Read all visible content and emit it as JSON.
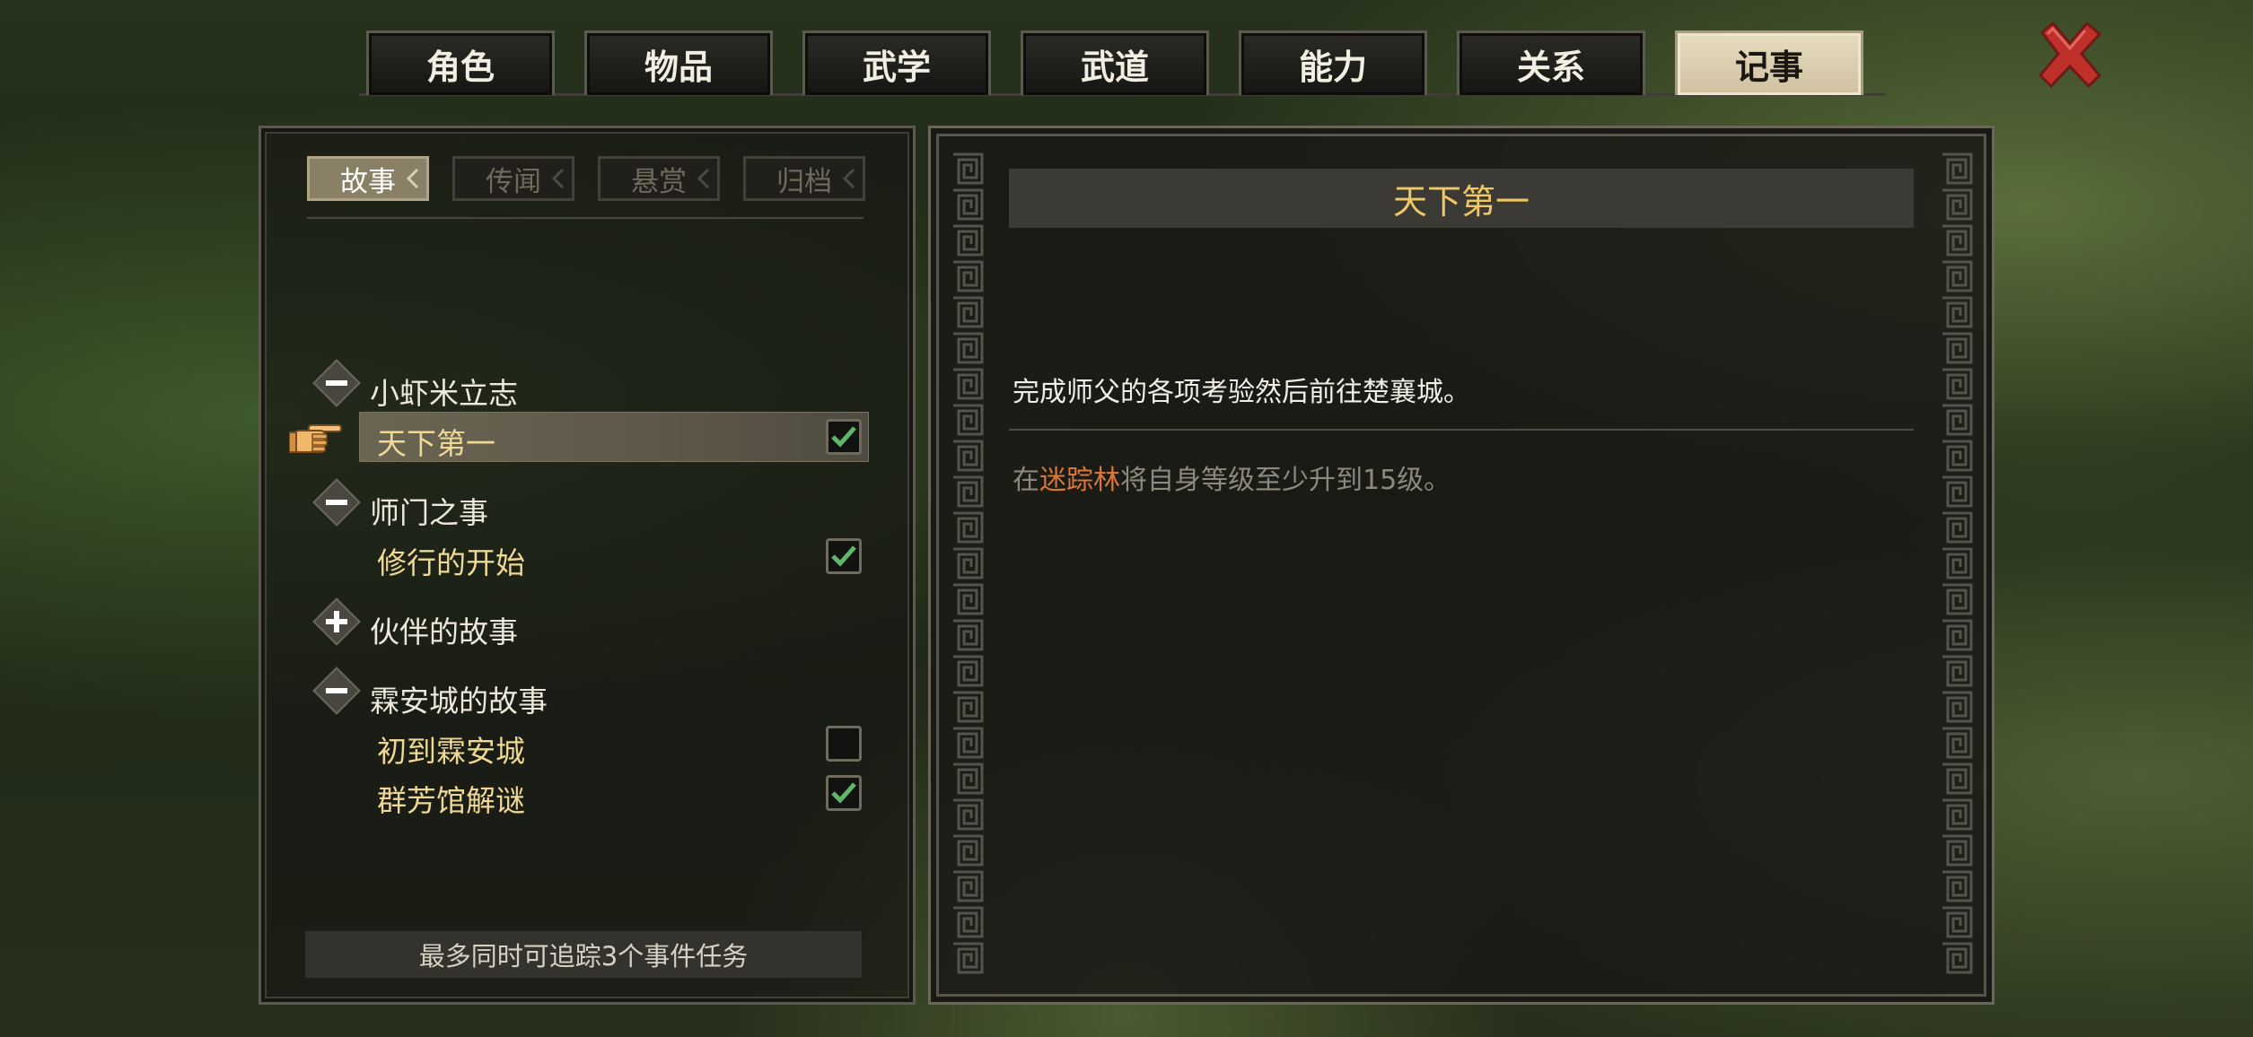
{
  "tabs": [
    {
      "label": "角色",
      "active": false
    },
    {
      "label": "物品",
      "active": false
    },
    {
      "label": "武学",
      "active": false
    },
    {
      "label": "武道",
      "active": false
    },
    {
      "label": "能力",
      "active": false
    },
    {
      "label": "关系",
      "active": false
    },
    {
      "label": "记事",
      "active": true
    }
  ],
  "subtabs": [
    {
      "label": "故事",
      "active": true
    },
    {
      "label": "传闻",
      "active": false
    },
    {
      "label": "悬赏",
      "active": false
    },
    {
      "label": "归档",
      "active": false
    }
  ],
  "quest_groups": [
    {
      "title": "小虾米立志",
      "expanded": true,
      "icon": "minus-icon",
      "quests": [
        {
          "label": "天下第一",
          "checked": true,
          "selected": true
        }
      ]
    },
    {
      "title": "师门之事",
      "expanded": true,
      "icon": "minus-icon",
      "quests": [
        {
          "label": "修行的开始",
          "checked": true,
          "selected": false
        }
      ]
    },
    {
      "title": "伙伴的故事",
      "expanded": false,
      "icon": "plus-icon",
      "quests": []
    },
    {
      "title": "霖安城的故事",
      "expanded": true,
      "icon": "minus-icon",
      "quests": [
        {
          "label": "初到霖安城",
          "checked": false,
          "selected": false
        },
        {
          "label": "群芳馆解谜",
          "checked": true,
          "selected": false
        }
      ]
    }
  ],
  "footer_note": "最多同时可追踪3个事件任务",
  "detail": {
    "title": "天下第一",
    "description": "完成师父的各项考验然后前往楚襄城。",
    "objective_prefix": "在",
    "objective_place": "迷踪林",
    "objective_suffix": "将自身等级至少升到15级。"
  },
  "colors": {
    "accent_gold": "#f0c864",
    "quest_yellow": "#efd794",
    "place_orange": "#d9763a",
    "close_red": "#c0302a",
    "check_green": "#5fb86a"
  }
}
